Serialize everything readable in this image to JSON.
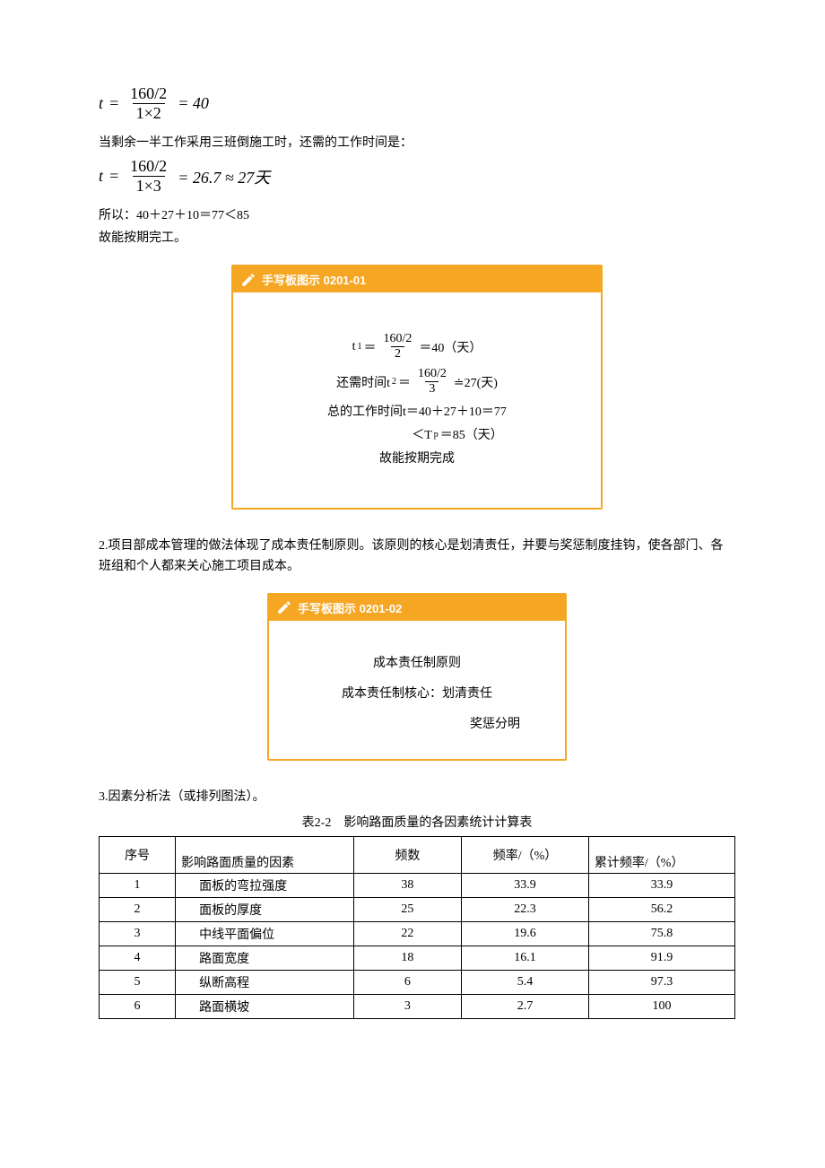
{
  "eq1": {
    "lhs": "t",
    "num": "160/2",
    "den": "1×2",
    "rhs": "= 40"
  },
  "p1": "当剩余一半工作采用三班倒施工时，还需的工作时间是：",
  "eq2": {
    "lhs": "t",
    "num": "160/2",
    "den": "1×3",
    "rhs": "= 26.7 ≈ 27天"
  },
  "p2": "所以：40＋27＋10＝77＜85",
  "p3": "故能按期完工。",
  "hw1": {
    "title": "手写板图示 0201-01",
    "lines": {
      "l1_a": "t",
      "l1_sub": "1",
      "l1_eq": "＝",
      "l1_num": "160/2",
      "l1_den": "2",
      "l1_b": "＝40（天）",
      "l2_a": "还需时间t",
      "l2_sub": "2",
      "l2_eq": "＝",
      "l2_num": "160/2",
      "l2_den": "3",
      "l2_b": "≐27(天)",
      "l3": "总的工作时间t＝40＋27＋10＝77",
      "l4_a": "＜T",
      "l4_sub": "p",
      "l4_b": "＝85（天）",
      "l5": "故能按期完成"
    }
  },
  "p4": "2.项目部成本管理的做法体现了成本责任制原则。该原则的核心是划清责任，并要与奖惩制度挂钩，使各部门、各班组和个人都来关心施工项目成本。",
  "hw2": {
    "title": "手写板图示 0201-02",
    "lines": {
      "l1": "成本责任制原则",
      "l2": "成本责任制核心：划清责任",
      "l3": "奖惩分明"
    }
  },
  "p5": "3.因素分析法（或排列图法）。",
  "table": {
    "caption": "表2-2 影响路面质量的各因素统计计算表",
    "headers": [
      "序号",
      "影响路面质量的因素",
      "频数",
      "频率/（%）",
      "累计频率/（%）"
    ],
    "rows": [
      [
        "1",
        "面板的弯拉强度",
        "38",
        "33.9",
        "33.9"
      ],
      [
        "2",
        "面板的厚度",
        "25",
        "22.3",
        "56.2"
      ],
      [
        "3",
        "中线平面偏位",
        "22",
        "19.6",
        "75.8"
      ],
      [
        "4",
        "路面宽度",
        "18",
        "16.1",
        "91.9"
      ],
      [
        "5",
        "纵断高程",
        "6",
        "5.4",
        "97.3"
      ],
      [
        "6",
        "路面横坡",
        "3",
        "2.7",
        "100"
      ]
    ]
  },
  "chart_data": {
    "type": "table",
    "title": "表2-2 影响路面质量的各因素统计计算表",
    "columns": [
      "序号",
      "影响路面质量的因素",
      "频数",
      "频率/（%）",
      "累计频率/（%）"
    ],
    "rows": [
      [
        1,
        "面板的弯拉强度",
        38,
        33.9,
        33.9
      ],
      [
        2,
        "面板的厚度",
        25,
        22.3,
        56.2
      ],
      [
        3,
        "中线平面偏位",
        22,
        19.6,
        75.8
      ],
      [
        4,
        "路面宽度",
        18,
        16.1,
        91.9
      ],
      [
        5,
        "纵断高程",
        6,
        5.4,
        97.3
      ],
      [
        6,
        "路面横坡",
        3,
        2.7,
        100
      ]
    ]
  }
}
